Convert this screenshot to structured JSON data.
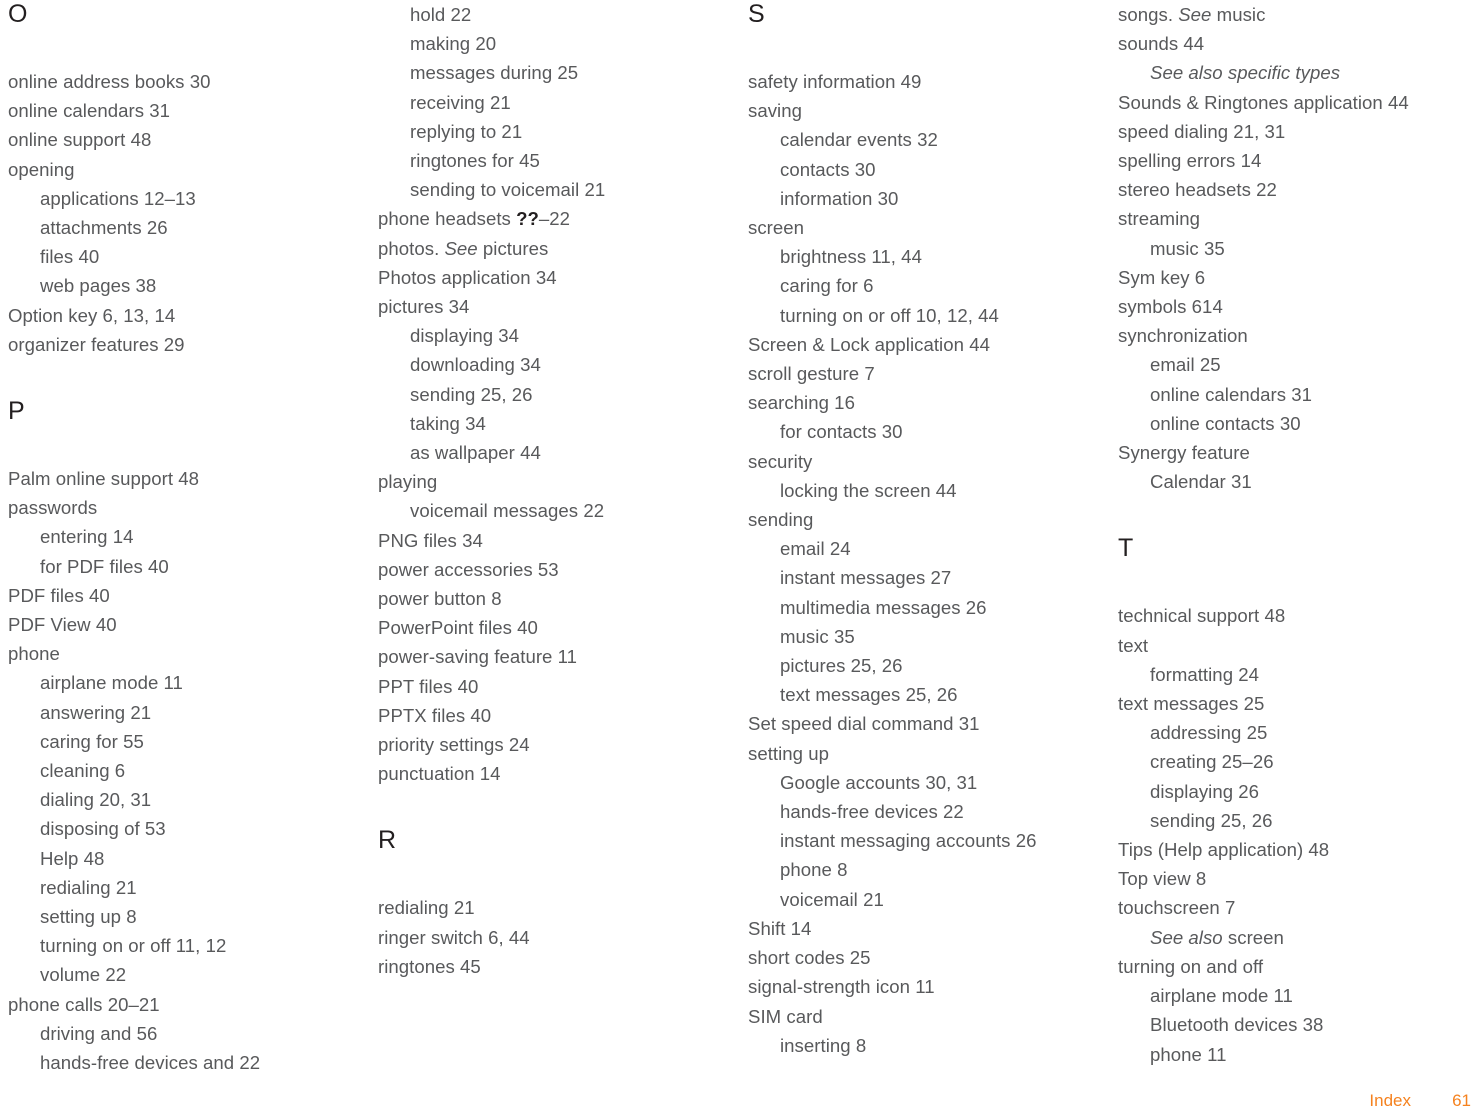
{
  "page": {
    "footer_label": "Index",
    "footer_number": "61",
    "accent_color": "#f5821f",
    "text_color": "#58595b",
    "heading_color": "#231f20"
  },
  "columns": [
    {
      "blocks": [
        {
          "type": "letter",
          "label": "O"
        },
        {
          "type": "entry",
          "level": 1,
          "text": "online address books 30"
        },
        {
          "type": "entry",
          "level": 1,
          "text": "online calendars 31"
        },
        {
          "type": "entry",
          "level": 1,
          "text": "online support 48"
        },
        {
          "type": "entry",
          "level": 1,
          "text": "opening"
        },
        {
          "type": "entry",
          "level": 2,
          "text": "applications 12–13"
        },
        {
          "type": "entry",
          "level": 2,
          "text": "attachments 26"
        },
        {
          "type": "entry",
          "level": 2,
          "text": "files 40"
        },
        {
          "type": "entry",
          "level": 2,
          "text": "web pages 38"
        },
        {
          "type": "entry",
          "level": 1,
          "text": "Option key 6, 13, 14"
        },
        {
          "type": "entry",
          "level": 1,
          "text": "organizer features 29"
        },
        {
          "type": "letter",
          "label": "P"
        },
        {
          "type": "entry",
          "level": 1,
          "text": "Palm online support 48"
        },
        {
          "type": "entry",
          "level": 1,
          "text": "passwords"
        },
        {
          "type": "entry",
          "level": 2,
          "text": "entering 14"
        },
        {
          "type": "entry",
          "level": 2,
          "text": "for PDF files 40"
        },
        {
          "type": "entry",
          "level": 1,
          "text": "PDF files 40"
        },
        {
          "type": "entry",
          "level": 1,
          "text": "PDF View 40"
        },
        {
          "type": "entry",
          "level": 1,
          "text": "phone"
        },
        {
          "type": "entry",
          "level": 2,
          "text": "airplane mode 11"
        },
        {
          "type": "entry",
          "level": 2,
          "text": "answering 21"
        },
        {
          "type": "entry",
          "level": 2,
          "text": "caring for 55"
        },
        {
          "type": "entry",
          "level": 2,
          "text": "cleaning 6"
        },
        {
          "type": "entry",
          "level": 2,
          "text": "dialing 20, 31"
        },
        {
          "type": "entry",
          "level": 2,
          "text": "disposing of 53"
        },
        {
          "type": "entry",
          "level": 2,
          "text": "Help 48"
        },
        {
          "type": "entry",
          "level": 2,
          "text": "redialing 21"
        },
        {
          "type": "entry",
          "level": 2,
          "text": "setting up 8"
        },
        {
          "type": "entry",
          "level": 2,
          "text": "turning on or off 11, 12"
        },
        {
          "type": "entry",
          "level": 2,
          "text": "volume 22"
        },
        {
          "type": "entry",
          "level": 1,
          "text": "phone calls 20–21"
        },
        {
          "type": "entry",
          "level": 2,
          "text": "driving and 56"
        },
        {
          "type": "entry",
          "level": 2,
          "text": "hands-free devices and 22"
        }
      ]
    },
    {
      "blocks": [
        {
          "type": "entry",
          "level": 2,
          "text": "hold 22"
        },
        {
          "type": "entry",
          "level": 2,
          "text": "making 20"
        },
        {
          "type": "entry",
          "level": 2,
          "text": "messages during 25"
        },
        {
          "type": "entry",
          "level": 2,
          "text": "receiving 21"
        },
        {
          "type": "entry",
          "level": 2,
          "text": "replying to 21"
        },
        {
          "type": "entry",
          "level": 2,
          "text": "ringtones for 45"
        },
        {
          "type": "entry",
          "level": 2,
          "text": "sending to voicemail 21"
        },
        {
          "type": "entry",
          "level": 1,
          "html": "phone headsets <span class=\"bold\">??</span>–22",
          "text": "phone headsets ??–22"
        },
        {
          "type": "entry",
          "level": 1,
          "html": "photos. <span class=\"it\">See</span> pictures",
          "text": "photos. See pictures"
        },
        {
          "type": "entry",
          "level": 1,
          "text": "Photos application 34"
        },
        {
          "type": "entry",
          "level": 1,
          "text": "pictures 34"
        },
        {
          "type": "entry",
          "level": 2,
          "text": "displaying 34"
        },
        {
          "type": "entry",
          "level": 2,
          "text": "downloading 34"
        },
        {
          "type": "entry",
          "level": 2,
          "text": "sending 25, 26"
        },
        {
          "type": "entry",
          "level": 2,
          "text": "taking 34"
        },
        {
          "type": "entry",
          "level": 2,
          "text": "as wallpaper 44"
        },
        {
          "type": "entry",
          "level": 1,
          "text": "playing"
        },
        {
          "type": "entry",
          "level": 2,
          "text": "voicemail messages 22"
        },
        {
          "type": "entry",
          "level": 1,
          "text": "PNG files 34"
        },
        {
          "type": "entry",
          "level": 1,
          "text": "power accessories 53"
        },
        {
          "type": "entry",
          "level": 1,
          "text": "power button 8"
        },
        {
          "type": "entry",
          "level": 1,
          "text": "PowerPoint files 40"
        },
        {
          "type": "entry",
          "level": 1,
          "text": "power-saving feature 11"
        },
        {
          "type": "entry",
          "level": 1,
          "text": "PPT files 40"
        },
        {
          "type": "entry",
          "level": 1,
          "text": "PPTX files 40"
        },
        {
          "type": "entry",
          "level": 1,
          "text": "priority settings 24"
        },
        {
          "type": "entry",
          "level": 1,
          "text": "punctuation 14"
        },
        {
          "type": "letter",
          "label": "R"
        },
        {
          "type": "entry",
          "level": 1,
          "text": "redialing 21"
        },
        {
          "type": "entry",
          "level": 1,
          "text": "ringer switch 6, 44"
        },
        {
          "type": "entry",
          "level": 1,
          "text": "ringtones 45"
        }
      ]
    },
    {
      "blocks": [
        {
          "type": "letter",
          "label": "S"
        },
        {
          "type": "entry",
          "level": 1,
          "text": "safety information 49"
        },
        {
          "type": "entry",
          "level": 1,
          "text": "saving"
        },
        {
          "type": "entry",
          "level": 2,
          "text": "calendar events 32"
        },
        {
          "type": "entry",
          "level": 2,
          "text": "contacts 30"
        },
        {
          "type": "entry",
          "level": 2,
          "text": "information 30"
        },
        {
          "type": "entry",
          "level": 1,
          "text": "screen"
        },
        {
          "type": "entry",
          "level": 2,
          "text": "brightness 11, 44"
        },
        {
          "type": "entry",
          "level": 2,
          "text": "caring for 6"
        },
        {
          "type": "entry",
          "level": 2,
          "text": "turning on or off 10, 12, 44"
        },
        {
          "type": "entry",
          "level": 1,
          "text": "Screen & Lock application 44"
        },
        {
          "type": "entry",
          "level": 1,
          "text": "scroll gesture 7"
        },
        {
          "type": "entry",
          "level": 1,
          "text": "searching 16"
        },
        {
          "type": "entry",
          "level": 2,
          "text": "for contacts 30"
        },
        {
          "type": "entry",
          "level": 1,
          "text": "security"
        },
        {
          "type": "entry",
          "level": 2,
          "text": "locking the screen 44"
        },
        {
          "type": "entry",
          "level": 1,
          "text": "sending"
        },
        {
          "type": "entry",
          "level": 2,
          "text": "email 24"
        },
        {
          "type": "entry",
          "level": 2,
          "text": "instant messages 27"
        },
        {
          "type": "entry",
          "level": 2,
          "text": "multimedia messages 26"
        },
        {
          "type": "entry",
          "level": 2,
          "text": "music 35"
        },
        {
          "type": "entry",
          "level": 2,
          "text": "pictures 25, 26"
        },
        {
          "type": "entry",
          "level": 2,
          "text": "text messages 25, 26"
        },
        {
          "type": "entry",
          "level": 1,
          "text": "Set speed dial command 31"
        },
        {
          "type": "entry",
          "level": 1,
          "text": "setting up"
        },
        {
          "type": "entry",
          "level": 2,
          "text": "Google accounts 30, 31"
        },
        {
          "type": "entry",
          "level": 2,
          "text": "hands-free devices 22"
        },
        {
          "type": "entry",
          "level": 2,
          "text": "instant messaging accounts 26"
        },
        {
          "type": "entry",
          "level": 2,
          "text": "phone 8"
        },
        {
          "type": "entry",
          "level": 2,
          "text": "voicemail 21"
        },
        {
          "type": "entry",
          "level": 1,
          "text": "Shift 14"
        },
        {
          "type": "entry",
          "level": 1,
          "text": "short codes 25"
        },
        {
          "type": "entry",
          "level": 1,
          "text": "signal-strength icon 11"
        },
        {
          "type": "entry",
          "level": 1,
          "text": "SIM card"
        },
        {
          "type": "entry",
          "level": 2,
          "text": "inserting 8"
        }
      ]
    },
    {
      "blocks": [
        {
          "type": "entry",
          "level": 1,
          "html": "songs. <span class=\"it\">See</span> music",
          "text": "songs. See music"
        },
        {
          "type": "entry",
          "level": 1,
          "text": "sounds 44"
        },
        {
          "type": "entry",
          "level": 2,
          "html": "<span class=\"it\">See also specific types</span>",
          "text": "See also specific types"
        },
        {
          "type": "entry",
          "level": 1,
          "text": "Sounds & Ringtones application 44"
        },
        {
          "type": "entry",
          "level": 1,
          "text": "speed dialing 21, 31"
        },
        {
          "type": "entry",
          "level": 1,
          "text": "spelling errors 14"
        },
        {
          "type": "entry",
          "level": 1,
          "text": "stereo headsets 22"
        },
        {
          "type": "entry",
          "level": 1,
          "text": "streaming"
        },
        {
          "type": "entry",
          "level": 2,
          "text": "music 35"
        },
        {
          "type": "entry",
          "level": 1,
          "text": "Sym key 6"
        },
        {
          "type": "entry",
          "level": 1,
          "text": "symbols 614"
        },
        {
          "type": "entry",
          "level": 1,
          "text": "synchronization"
        },
        {
          "type": "entry",
          "level": 2,
          "text": "email 25"
        },
        {
          "type": "entry",
          "level": 2,
          "text": "online calendars 31"
        },
        {
          "type": "entry",
          "level": 2,
          "text": "online contacts 30"
        },
        {
          "type": "entry",
          "level": 1,
          "text": "Synergy feature"
        },
        {
          "type": "entry",
          "level": 2,
          "text": "Calendar 31"
        },
        {
          "type": "letter",
          "label": "T"
        },
        {
          "type": "entry",
          "level": 1,
          "text": "technical support 48"
        },
        {
          "type": "entry",
          "level": 1,
          "text": "text"
        },
        {
          "type": "entry",
          "level": 2,
          "text": "formatting 24"
        },
        {
          "type": "entry",
          "level": 1,
          "text": "text messages 25"
        },
        {
          "type": "entry",
          "level": 2,
          "text": "addressing 25"
        },
        {
          "type": "entry",
          "level": 2,
          "text": "creating 25–26"
        },
        {
          "type": "entry",
          "level": 2,
          "text": "displaying 26"
        },
        {
          "type": "entry",
          "level": 2,
          "text": "sending 25, 26"
        },
        {
          "type": "entry",
          "level": 1,
          "text": "Tips (Help application) 48"
        },
        {
          "type": "entry",
          "level": 1,
          "text": "Top view 8"
        },
        {
          "type": "entry",
          "level": 1,
          "text": "touchscreen 7"
        },
        {
          "type": "entry",
          "level": 2,
          "html": "<span class=\"it\">See also</span> screen",
          "text": "See also screen"
        },
        {
          "type": "entry",
          "level": 1,
          "text": "turning on and off"
        },
        {
          "type": "entry",
          "level": 2,
          "text": "airplane mode 11"
        },
        {
          "type": "entry",
          "level": 2,
          "text": "Bluetooth devices 38"
        },
        {
          "type": "entry",
          "level": 2,
          "text": "phone 11"
        }
      ]
    }
  ]
}
